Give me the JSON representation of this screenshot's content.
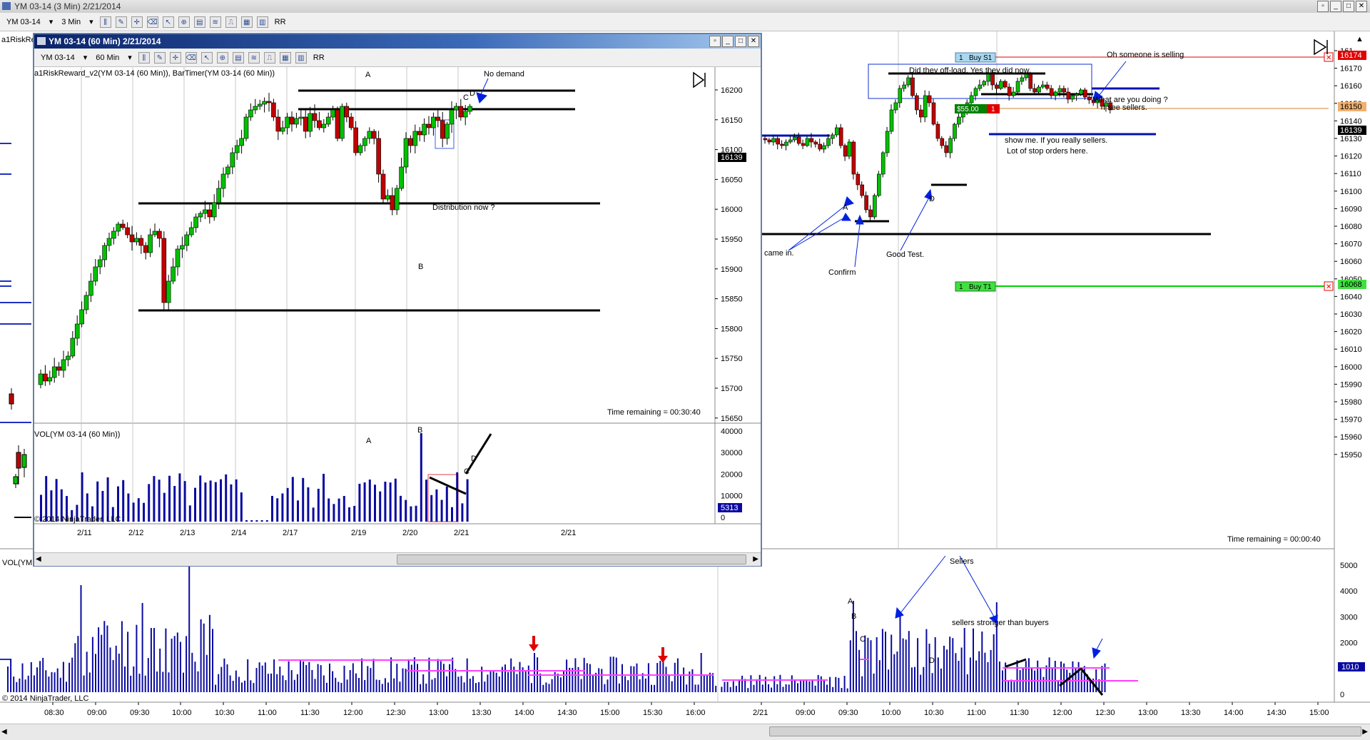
{
  "window": {
    "title": "YM 03-14 (3 Min)  2/21/2014"
  },
  "main_toolbar": {
    "instrument": "YM 03-14",
    "period": "3 Min",
    "rr_label": "RR"
  },
  "left_strip_label": "a1RiskRe",
  "child": {
    "title": "YM 03-14 (60 Min)  2/21/2014",
    "toolbar": {
      "instrument": "YM 03-14",
      "period": "60 Min",
      "rr_label": "RR"
    },
    "indicator_label": "a1RiskReward_v2(YM 03-14 (60 Min)), BarTimer(YM 03-14 (60 Min))",
    "vol_label": "VOL(YM 03-14 (60 Min))",
    "time_remaining": "Time remaining = 00:30:40",
    "copyright": "© 2014 NinjaTrader, LLC",
    "price_labels": [
      "16200",
      "16150",
      "16100",
      "16050",
      "16000",
      "15950",
      "15900",
      "15850",
      "15800",
      "15750",
      "15700",
      "15650"
    ],
    "current_price": "16139",
    "vol_labels": [
      "40000",
      "30000",
      "20000",
      "10000",
      "0"
    ],
    "current_vol": "5313",
    "date_labels": [
      "2/11",
      "2/12",
      "2/13",
      "2/14",
      "2/17",
      "2/19",
      "2/20",
      "2/21",
      "2/21"
    ],
    "annotations": {
      "no_demand": "No demand",
      "distribution": "Distribution now ?",
      "A": "A",
      "B": "B",
      "C": "C",
      "D": "D"
    }
  },
  "main_chart": {
    "price_labels": [
      "161",
      "16170",
      "16160",
      "16150",
      "16140",
      "16130",
      "16120",
      "16110",
      "16100",
      "16090",
      "16080",
      "16070",
      "16060",
      "16050",
      "16040",
      "16030",
      "16020",
      "16010",
      "16000",
      "15990",
      "15980",
      "15970",
      "15960",
      "15950"
    ],
    "current_price": "16139",
    "stop_price": "16174",
    "target_price": "16068",
    "entry_price": "16150",
    "buy_s1": "Buy S1",
    "buy_t1": "Buy T1",
    "qty": "1",
    "pnl": "$55.00",
    "time_remaining": "Time remaining = 00:00:40",
    "annotations": {
      "offload": "Did they off-load. Yes they did now",
      "selling": "Oh someone is selling",
      "doing": "What are you doing ?",
      "see_sellers": "I see sellers.",
      "show_me": "show me. If you really sellers.",
      "stops": "Lot of stop orders here.",
      "came_in": "came in.",
      "confirm": "Confirm",
      "good_test": "Good Test.",
      "A": "A",
      "D": "D"
    }
  },
  "vol_panel": {
    "label": "VOL(YM",
    "copyright": "© 2014 NinjaTrader, LLC",
    "labels": [
      "5000",
      "4000",
      "3000",
      "2000",
      "1000",
      "0"
    ],
    "current_vol": "1010",
    "sellers": "Sellers",
    "stronger": "sellers stronger than buyers",
    "A": "A",
    "B": "B",
    "C": "C",
    "D": "D"
  },
  "time_axis": [
    "08:30",
    "09:00",
    "09:30",
    "10:00",
    "10:30",
    "11:00",
    "11:30",
    "12:00",
    "12:30",
    "13:00",
    "13:30",
    "14:00",
    "14:30",
    "15:00",
    "15:30",
    "16:00",
    "2/21",
    "09:00",
    "09:30",
    "10:00",
    "10:30",
    "11:00",
    "11:30",
    "12:00",
    "12:30",
    "13:00",
    "13:30",
    "14:00",
    "14:30",
    "15:00"
  ],
  "colors": {
    "up": "#00c000",
    "down": "#c00000",
    "vol": "#0a0aa0",
    "annot": "#0020e0",
    "pink": "#ff40ff"
  }
}
